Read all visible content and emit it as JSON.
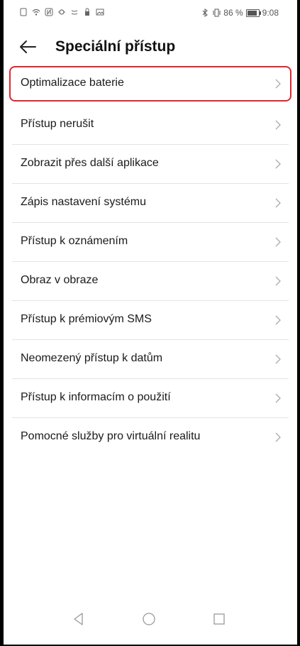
{
  "status_bar": {
    "battery_text": "86 %",
    "time": "9:08",
    "icons": [
      "sim-icon",
      "wifi-icon",
      "nfc-icon",
      "sync-icon",
      "cast-icon",
      "lock-icon",
      "image-icon",
      "bluetooth-icon",
      "vibrate-icon",
      "battery-icon"
    ]
  },
  "header": {
    "title": "Speciální přístup",
    "back_icon": "arrow-left-icon"
  },
  "items": [
    {
      "label": "Optimalizace baterie",
      "highlighted": true
    },
    {
      "label": "Přístup nerušit"
    },
    {
      "label": "Zobrazit přes další aplikace"
    },
    {
      "label": "Zápis nastavení systému"
    },
    {
      "label": "Přístup k oznámením"
    },
    {
      "label": "Obraz v obraze"
    },
    {
      "label": "Přístup k prémiovým SMS"
    },
    {
      "label": "Neomezený přístup k datům"
    },
    {
      "label": "Přístup k informacím o použití"
    },
    {
      "label": "Pomocné služby pro virtuální realitu"
    }
  ],
  "colors": {
    "highlight_border": "#e5242c",
    "divider": "#e3e3e3"
  },
  "navbar": {
    "buttons": [
      "back-triangle-icon",
      "home-circle-icon",
      "recents-square-icon"
    ]
  }
}
